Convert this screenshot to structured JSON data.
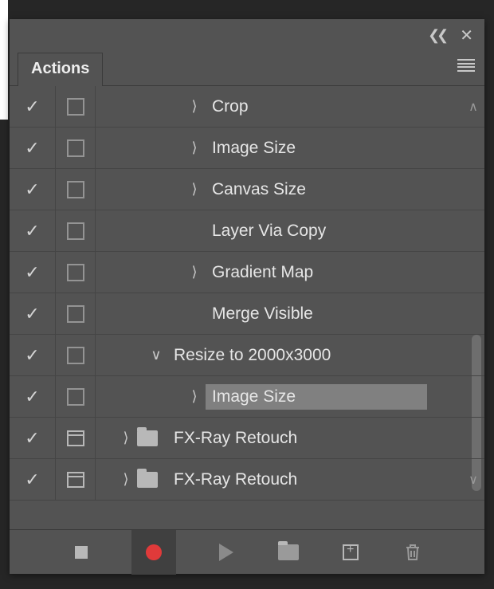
{
  "panel": {
    "title": "Actions"
  },
  "rows": [
    {
      "label": "Crop",
      "indent": 110,
      "twist": "right",
      "checked": true,
      "box": true,
      "dialog": false,
      "selected": false,
      "arrow": "up"
    },
    {
      "label": "Image Size",
      "indent": 110,
      "twist": "right",
      "checked": true,
      "box": true,
      "dialog": false,
      "selected": false
    },
    {
      "label": "Canvas Size",
      "indent": 110,
      "twist": "right",
      "checked": true,
      "box": true,
      "dialog": false,
      "selected": false
    },
    {
      "label": "Layer Via Copy",
      "indent": 110,
      "twist": "",
      "checked": true,
      "box": true,
      "dialog": false,
      "selected": false
    },
    {
      "label": "Gradient Map",
      "indent": 110,
      "twist": "right",
      "checked": true,
      "box": true,
      "dialog": false,
      "selected": false
    },
    {
      "label": "Merge Visible",
      "indent": 110,
      "twist": "",
      "checked": true,
      "box": true,
      "dialog": false,
      "selected": false
    },
    {
      "label": "Resize to 2000x3000",
      "indent": 62,
      "twist": "down",
      "checked": true,
      "box": true,
      "dialog": false,
      "selected": false
    },
    {
      "label": "Image Size",
      "indent": 110,
      "twist": "right",
      "checked": true,
      "box": true,
      "dialog": false,
      "selected": true
    },
    {
      "label": "FX-Ray Retouch",
      "indent": 24,
      "twist": "right",
      "checked": true,
      "box": false,
      "dialog": true,
      "folder": true,
      "selected": false
    },
    {
      "label": "FX-Ray Retouch",
      "indent": 24,
      "twist": "right",
      "checked": true,
      "box": false,
      "dialog": true,
      "folder": true,
      "selected": false,
      "arrow": "down"
    }
  ],
  "toolbar": {
    "stop": "Stop",
    "record": "Record",
    "play": "Play",
    "newset": "New Set",
    "new": "New Action",
    "delete": "Delete"
  }
}
